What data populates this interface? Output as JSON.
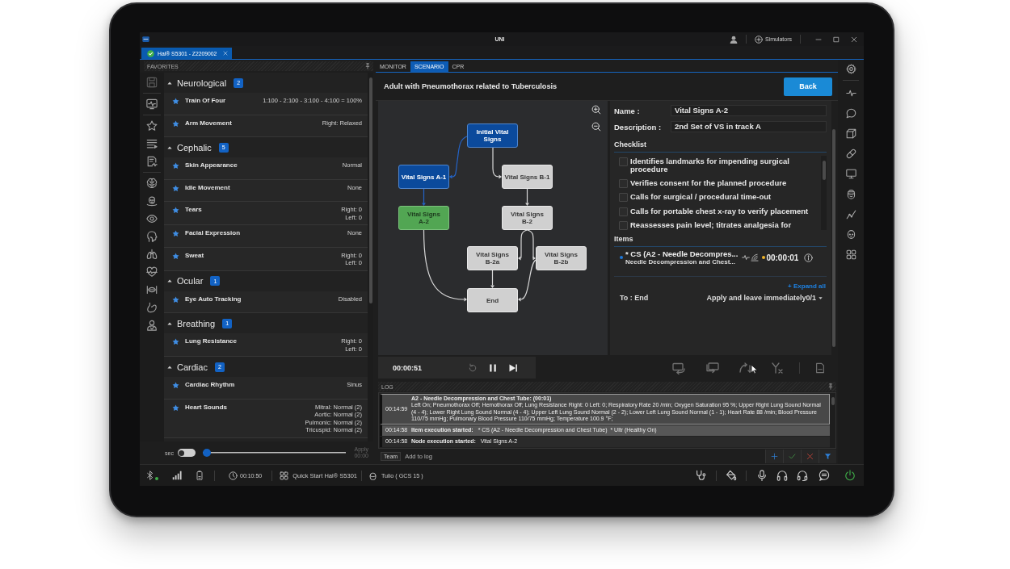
{
  "title_bar": {
    "title": "UNI",
    "simulators_label": "Simulators"
  },
  "tabs": [
    {
      "label": "Hal® S5301 - Z2209002",
      "selected": true,
      "connected": true
    }
  ],
  "favorites": {
    "title": "FAVORITES",
    "groups": [
      {
        "name": "Neurological",
        "count": "2",
        "expanded": true,
        "items": [
          {
            "label": "Train Of Four",
            "values": [
              "1:100 - 2:100 - 3:100 - 4:100 = 100%"
            ],
            "starred": true
          },
          {
            "label": "Arm Movement",
            "values": [
              "Right: Relaxed"
            ],
            "starred": true
          }
        ]
      },
      {
        "name": "Cephalic",
        "count": "5",
        "expanded": true,
        "items": [
          {
            "label": "Skin Appearance",
            "values": [
              "Normal"
            ],
            "starred": true
          },
          {
            "label": "Idle Movement",
            "values": [
              "None"
            ],
            "starred": true
          },
          {
            "label": "Tears",
            "values": [
              "Right: 0",
              "Left: 0"
            ],
            "starred": true
          },
          {
            "label": "Facial Expression",
            "values": [
              "None"
            ],
            "starred": true
          },
          {
            "label": "Sweat",
            "values": [
              "Right: 0",
              "Left: 0"
            ],
            "starred": true
          }
        ]
      },
      {
        "name": "Ocular",
        "count": "1",
        "expanded": true,
        "items": [
          {
            "label": "Eye Auto Tracking",
            "values": [
              "Disabled"
            ],
            "starred": true
          }
        ]
      },
      {
        "name": "Breathing",
        "count": "1",
        "expanded": true,
        "items": [
          {
            "label": "Lung Resistance",
            "values": [
              "Right: 0",
              "Left: 0"
            ],
            "starred": true
          }
        ]
      },
      {
        "name": "Cardiac",
        "count": "2",
        "expanded": true,
        "items": [
          {
            "label": "Cardiac Rhythm",
            "values": [
              "Sinus"
            ],
            "starred": true
          },
          {
            "label": "Heart Sounds",
            "values": [
              "Mitral: Normal (2)",
              "Aortic: Normal (2)",
              "Pulmonic: Normal (2)",
              "Tricuspid: Normal (2)"
            ],
            "starred": true
          }
        ]
      }
    ]
  },
  "timer": {
    "unit": "sec",
    "on": false,
    "level": 0,
    "apply_label": "Apply",
    "apply_time": "00:00",
    "apply_disabled": true
  },
  "view_tabs": [
    {
      "label": "MONITOR",
      "selected": false
    },
    {
      "label": "SCENARIO",
      "selected": true
    },
    {
      "label": "CPR",
      "selected": false
    }
  ],
  "scenario": {
    "title": "Adult with Pneumothorax related to Tuberculosis",
    "back_label": "Back"
  },
  "flowchart": {
    "nodes": [
      {
        "label": "Initial Vital Signs",
        "completed": true,
        "current": false
      },
      {
        "label": "Vital Signs A-1",
        "completed": true,
        "current": false
      },
      {
        "label": "Vital Signs B-1",
        "completed": false,
        "current": false
      },
      {
        "label": "Vital Signs A-2",
        "completed": false,
        "current": true
      },
      {
        "label": "Vital Signs B-2",
        "completed": false,
        "current": false
      },
      {
        "label": "Vital Signs B-2a",
        "completed": false,
        "current": false
      },
      {
        "label": "Vital Signs B-2b",
        "completed": false,
        "current": false
      },
      {
        "label": "End",
        "completed": false,
        "current": false
      }
    ],
    "edges": [
      {
        "taken": true
      },
      {
        "taken": false
      },
      {
        "taken": true
      },
      {
        "taken": false
      },
      {
        "taken": false
      },
      {
        "taken": false
      },
      {
        "taken": false
      },
      {
        "taken": false
      },
      {
        "taken": false
      }
    ]
  },
  "node_details": {
    "name_label": "Name :",
    "name": "Vital Signs A-2",
    "description_label": "Description :",
    "description": "2nd Set of VS in track A",
    "checklist_title": "Checklist",
    "checklist": [
      {
        "label": "Identifies landmarks for impending surgical procedure",
        "checked": false
      },
      {
        "label": "Verifies consent for the planned procedure",
        "checked": false
      },
      {
        "label": "Calls for surgical / procedural time-out",
        "checked": false
      },
      {
        "label": "Calls for portable chest x-ray to verify placement",
        "checked": false
      },
      {
        "label": "Reassesses pain level; titrates analgesia for",
        "checked": false
      }
    ],
    "items_title": "Items",
    "items": [
      {
        "title": "* CS (A2 - Needle Decompres...",
        "subtitle": "Needle Decompression and Chest...",
        "time": "00:00:01"
      }
    ],
    "expand_all": "+ Expand all",
    "transition": {
      "target": "To : End",
      "action": "Apply and leave immediately0/1"
    }
  },
  "playback": {
    "time": "00:00:51",
    "replay_disabled": true
  },
  "log": {
    "title": "LOG",
    "entries": [
      {
        "kind": "result",
        "time": "00:14:59",
        "title": "A2 - Needle Decompression and Chest Tube: (00:01)",
        "text": "Left On; Pneumothorax Off; Hemothorax Off; Lung Resistance Right: 0 Left: 0; Respiratory Rate 20 /min; Oxygen Saturation 95 %; Upper Right Lung Sound Normal (4 - 4); Lower Right Lung Sound Normal (4 - 4); Upper Left Lung Sound Normal (2 - 2); Lower Left Lung Sound Normal (1 - 1); Heart Rate 88 /min; Blood Pressure 110/75 mmHg; Pulmonary Blood Pressure 110/75 mmHg; Temperature 100.9 °F;",
        "selected": true
      },
      {
        "kind": "item",
        "time": "00:14:58",
        "label": "Item execution started:",
        "text": "* CS (A2 - Needle Decompression and Chest Tube)  * Ultr (Healthy On)",
        "selected": false
      },
      {
        "kind": "node",
        "time": "00:14:58",
        "label": "Node execution started:",
        "text": "Vital Signs A-2",
        "selected": false
      }
    ],
    "team_label": "Team",
    "placeholder": "Add to log"
  },
  "status_bar": {
    "bluetooth_connected": true,
    "clock": "00:10:50",
    "scenario": "Quick Start Hal® S5301",
    "patient": "Tulio ( GCS 15 )"
  }
}
